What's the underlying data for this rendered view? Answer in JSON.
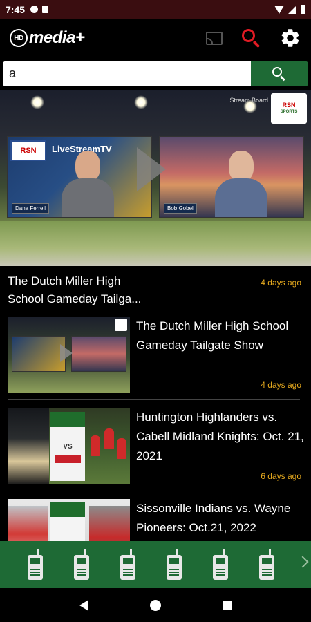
{
  "status_bar": {
    "time": "7:45"
  },
  "app": {
    "logo_text": "media+",
    "logo_badge": "HD"
  },
  "icons": {
    "cast": "cast-icon",
    "search": "search-icon",
    "settings": "gear-icon",
    "bottom_nav": "phone-icon"
  },
  "colors": {
    "brand_green": "#1e6a35",
    "accent_red": "#e01b24",
    "age_gold": "#e5a91e"
  },
  "search": {
    "value": "a"
  },
  "hero": {
    "caption": "Stream Board",
    "badge": "RSN",
    "panel_title": "LiveStreamTV",
    "host_left": "Dana Ferrell",
    "host_right": "Bob Gobel"
  },
  "featured": {
    "title": "The Dutch Miller High School Gameday Tailga...",
    "age": "4 days ago"
  },
  "videos": [
    {
      "title": "The Dutch Miller High School Gameday Tailgate Show",
      "age": "4 days ago"
    },
    {
      "title": "Huntington Highlanders vs. Cabell Midland Knights: Oct. 21, 2021",
      "age": "6 days ago"
    },
    {
      "title": "Sissonville Indians vs. Wayne Pioneers: Oct.21, 2022",
      "age": ""
    }
  ],
  "thumb_text": {
    "poster_vs": "VS"
  }
}
